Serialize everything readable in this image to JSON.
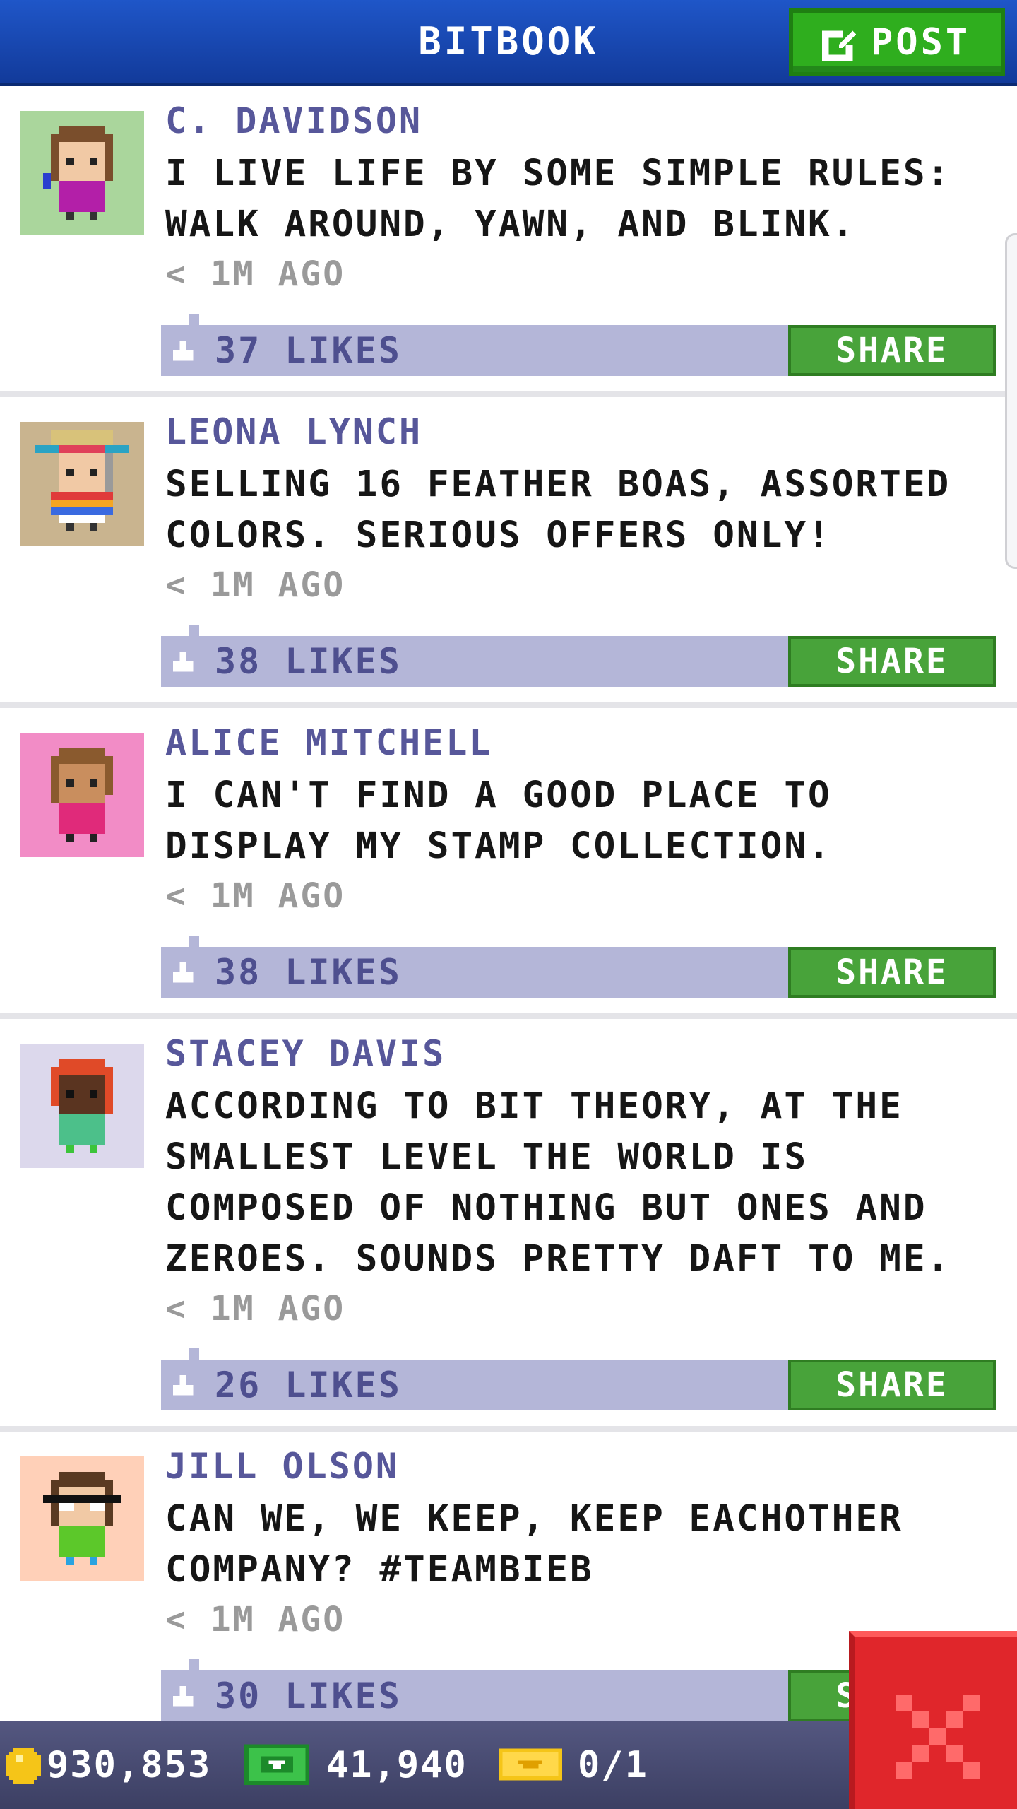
{
  "header": {
    "title": "BITBOOK",
    "post_label": "POST"
  },
  "posts": [
    {
      "author": "C. DAVIDSON",
      "text": "I LIVE LIFE BY SOME SIMPLE RULES: WALK AROUND, YAWN, AND BLINK.",
      "time": "< 1M AGO",
      "likes": "37 LIKES",
      "share": "SHARE",
      "avatar_bg": "#aad69c"
    },
    {
      "author": "LEONA LYNCH",
      "text": "SELLING 16 FEATHER BOAS, ASSORTED COLORS. SERIOUS OFFERS ONLY!",
      "time": "< 1M AGO",
      "likes": "38 LIKES",
      "share": "SHARE",
      "avatar_bg": "#c9b48f"
    },
    {
      "author": "ALICE MITCHELL",
      "text": "I CAN'T FIND A GOOD PLACE TO DISPLAY MY STAMP COLLECTION.",
      "time": "< 1M AGO",
      "likes": "38 LIKES",
      "share": "SHARE",
      "avatar_bg": "#f28cc6"
    },
    {
      "author": "STACEY DAVIS",
      "text": "ACCORDING TO BIT THEORY, AT THE SMALLEST LEVEL THE WORLD IS COMPOSED OF NOTHING BUT ONES AND ZEROES. SOUNDS PRETTY DAFT TO ME.",
      "time": "< 1M AGO",
      "likes": "26 LIKES",
      "share": "SHARE",
      "avatar_bg": "#dcd8ec"
    },
    {
      "author": "JILL OLSON",
      "text": "CAN WE, WE KEEP, KEEP EACHOTHER COMPANY? #TEAMBIEB",
      "time": "< 1M AGO",
      "likes": "30 LIKES",
      "share": "SHARE",
      "avatar_bg": "#ffd0b8"
    }
  ],
  "footer": {
    "coins": "930,853",
    "cash": "41,940",
    "tickets": "0/1"
  },
  "colors": {
    "header": "#1a4fbf",
    "post_button": "#2fae1e",
    "share_button": "#48a33a",
    "likes_bar": "#b4b6d8",
    "close_button": "#e0262b"
  },
  "icons": {
    "post": "edit-icon",
    "like": "thumbs-up-icon",
    "coin": "coin-icon",
    "cash": "cash-icon",
    "ticket": "ticket-icon",
    "close": "close-icon"
  }
}
